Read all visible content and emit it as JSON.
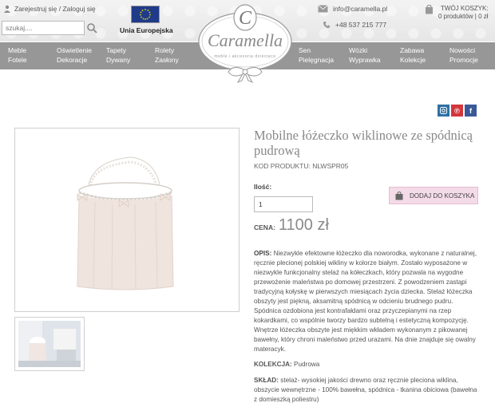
{
  "header": {
    "login_text": "Zarejestruj się / Zaloguj się",
    "search_placeholder": "szukaj....",
    "eu_label": "Unia Europejska",
    "email": "info@caramella.pl",
    "phone": "+48 537 215 777",
    "cart_title": "TWÓJ KOSZYK:",
    "cart_summary": "0 produktów | 0 zł"
  },
  "logo": {
    "letter": "C",
    "brand": "Caramella",
    "tagline": "meble i akcesoria dziecięce"
  },
  "nav": {
    "items": [
      {
        "line1": "Meble",
        "line2": "Fotele"
      },
      {
        "line1": "Oświetlenie",
        "line2": "Dekoracje"
      },
      {
        "line1": "Tapety",
        "line2": "Dywany"
      },
      {
        "line1": "Rolety",
        "line2": "Zasłony"
      },
      {
        "line1": "Sen",
        "line2": "Pielęgnacja"
      },
      {
        "line1": "Wózki",
        "line2": "Wyprawka"
      },
      {
        "line1": "Zabawa",
        "line2": "Kolekcje"
      },
      {
        "line1": "Nowości",
        "line2": "Promocje"
      }
    ]
  },
  "social": {
    "instagram_color": "#2f6fa3",
    "pinterest_color": "#d2373c",
    "facebook_color": "#3b5998",
    "pinterest_glyph": "℗",
    "facebook_glyph": "f"
  },
  "product": {
    "title": "Mobilne łóżeczko wiklinowe ze spódnicą pudrową",
    "code": "KOD PRODUKTU: NLWSPR05",
    "qty_label": "Ilość:",
    "qty_value": "1",
    "add_to_cart": "DODAJ DO KOSZYKA",
    "price_label": "CENA:",
    "price": "1100 zł",
    "desc_label": "OPIS:",
    "description": "Niezwykle efektowne łóżeczko dla noworodka, wykonane z naturalnej, ręcznie plecionej polskiej wikliny w kolorze białym. Zostało wyposażone w niezwykle funkcjonalny stelaż na kółeczkach, który pozwala na wygodne przewożenie maleństwa po domowej przestrzeni. Z powodzeniem zastąpi tradycyjną kołyskę w pierwszych miesiącach życia dziecka. Stelaż łóżeczka obszyty jest piękną, aksamitną spódnicą w odcieniu brudnego pudru. Spódnica ozdobiona jest kontrafałdami oraz przyczepianymi na rzep kokardkami, co wspólnie tworzy bardzo subtelną i estetyczną kompozycję. Wnętrze łóżeczka obszyte jest miękkim wkładem wykonanym z pikowanej bawełny, który chroni maleństwo przed urazami. Na dnie znajduje się owalny materacyk.",
    "collection_label": "KOLEKCJA:",
    "collection": "Pudrowa",
    "composition_label": "SKŁAD:",
    "composition": "stelaż- wysokiej jakości drewno oraz ręcznie pleciona wiklina, obszycie wewnętrzne - 100% bawełna, spódnica - tkanina obiciowa (bawełna z domieszką poliestru)"
  },
  "colors": {
    "nav_bg": "#979797",
    "cart_button_bg": "#f3dbe8",
    "skirt": "#eee2dc"
  }
}
